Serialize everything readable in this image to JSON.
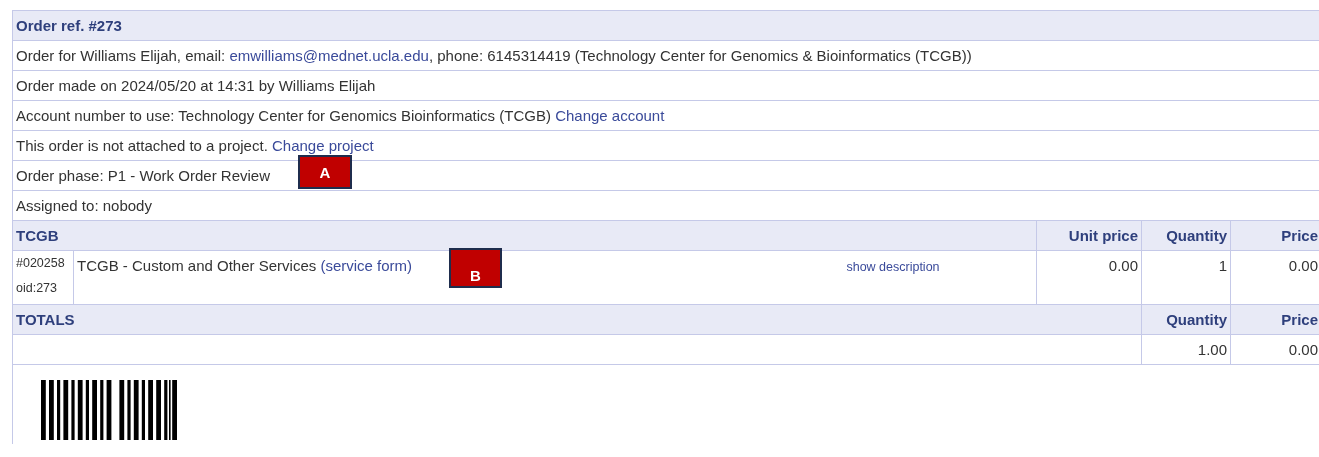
{
  "order_header": "Order ref. #273",
  "info_rows": [
    {
      "parts": [
        {
          "kind": "text",
          "text": "Order for Williams Elijah, email: "
        },
        {
          "kind": "link",
          "text": "emwilliams@mednet.ucla.edu"
        },
        {
          "kind": "text",
          "text": ", phone: 6145314419 (Technology Center for Genomics & Bioinformatics (TCGB))"
        }
      ]
    },
    {
      "parts": [
        {
          "kind": "text",
          "text": "Order made on 2024/05/20 at 14:31 by Williams Elijah"
        }
      ]
    },
    {
      "parts": [
        {
          "kind": "text",
          "text": "Account number to use: Technology Center for Genomics Bioinformatics (TCGB) "
        },
        {
          "kind": "link",
          "text": "Change account"
        }
      ]
    },
    {
      "parts": [
        {
          "kind": "text",
          "text": "This order is not attached to a project. "
        },
        {
          "kind": "link",
          "text": "Change project"
        }
      ]
    },
    {
      "parts": [
        {
          "kind": "text",
          "text": "Order phase: P1 - Work Order Review"
        }
      ]
    },
    {
      "parts": [
        {
          "kind": "text",
          "text": "Assigned to: nobody"
        }
      ]
    }
  ],
  "items_table": {
    "title": "TCGB",
    "columns": [
      "Unit price",
      "Quantity",
      "Price"
    ],
    "rows": [
      {
        "code": "#020258",
        "oid": "oid:273",
        "name": "TCGB - Custom and Other Services",
        "form_link": "(service form)",
        "description_link": "show description",
        "unit_price": "0.00",
        "quantity": "1",
        "price": "0.00"
      }
    ]
  },
  "totals": {
    "title": "TOTALS",
    "columns": [
      "Quantity",
      "Price"
    ],
    "quantity": "1.00",
    "price": "0.00"
  },
  "annotations": [
    {
      "label": "A"
    },
    {
      "label": "B"
    }
  ]
}
